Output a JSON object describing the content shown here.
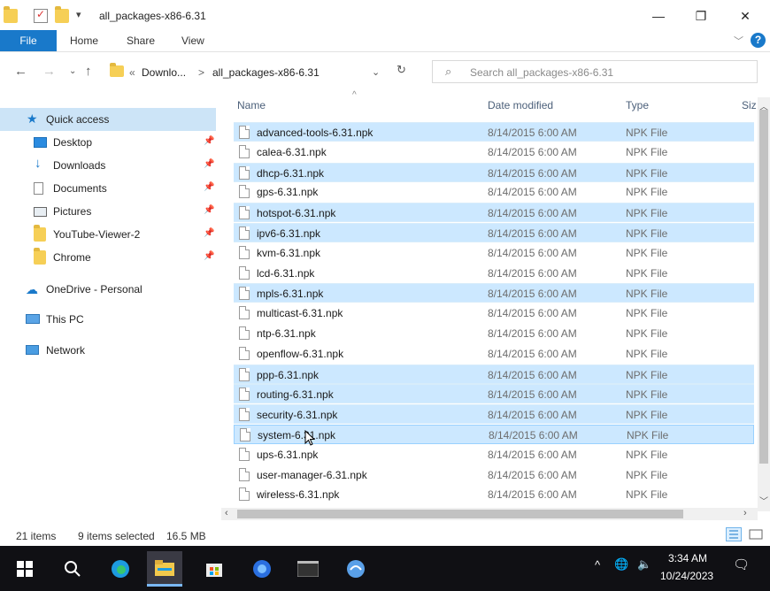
{
  "window": {
    "title": "all_packages-x86-6.31",
    "minimize": "—",
    "restore": "❐",
    "close": "✕"
  },
  "ribbon": {
    "tabs": [
      "File",
      "Home",
      "Share",
      "View"
    ],
    "help": "?"
  },
  "address": {
    "breadcrumb_prefix": "«",
    "crumbs": [
      "Downlo...",
      "all_packages-x86-6.31"
    ],
    "separator": ">"
  },
  "search": {
    "placeholder": "Search all_packages-x86-6.31"
  },
  "nav": {
    "items": [
      {
        "label": "Quick access"
      },
      {
        "label": "Desktop"
      },
      {
        "label": "Downloads"
      },
      {
        "label": "Documents"
      },
      {
        "label": "Pictures"
      },
      {
        "label": "YouTube-Viewer-2"
      },
      {
        "label": "Chrome"
      },
      {
        "label": "OneDrive - Personal"
      },
      {
        "label": "This PC"
      },
      {
        "label": "Network"
      }
    ]
  },
  "columns": {
    "name": "Name",
    "date": "Date modified",
    "type": "Type",
    "size": "Siz"
  },
  "files": [
    {
      "name": "advanced-tools-6.31.npk",
      "date": "8/14/2015 6:00 AM",
      "type": "NPK File",
      "selected": true
    },
    {
      "name": "calea-6.31.npk",
      "date": "8/14/2015 6:00 AM",
      "type": "NPK File",
      "selected": false
    },
    {
      "name": "dhcp-6.31.npk",
      "date": "8/14/2015 6:00 AM",
      "type": "NPK File",
      "selected": true
    },
    {
      "name": "gps-6.31.npk",
      "date": "8/14/2015 6:00 AM",
      "type": "NPK File",
      "selected": false
    },
    {
      "name": "hotspot-6.31.npk",
      "date": "8/14/2015 6:00 AM",
      "type": "NPK File",
      "selected": true
    },
    {
      "name": "ipv6-6.31.npk",
      "date": "8/14/2015 6:00 AM",
      "type": "NPK File",
      "selected": true
    },
    {
      "name": "kvm-6.31.npk",
      "date": "8/14/2015 6:00 AM",
      "type": "NPK File",
      "selected": false
    },
    {
      "name": "lcd-6.31.npk",
      "date": "8/14/2015 6:00 AM",
      "type": "NPK File",
      "selected": false
    },
    {
      "name": "mpls-6.31.npk",
      "date": "8/14/2015 6:00 AM",
      "type": "NPK File",
      "selected": true
    },
    {
      "name": "multicast-6.31.npk",
      "date": "8/14/2015 6:00 AM",
      "type": "NPK File",
      "selected": false
    },
    {
      "name": "ntp-6.31.npk",
      "date": "8/14/2015 6:00 AM",
      "type": "NPK File",
      "selected": false
    },
    {
      "name": "openflow-6.31.npk",
      "date": "8/14/2015 6:00 AM",
      "type": "NPK File",
      "selected": false
    },
    {
      "name": "ppp-6.31.npk",
      "date": "8/14/2015 6:00 AM",
      "type": "NPK File",
      "selected": true
    },
    {
      "name": "routing-6.31.npk",
      "date": "8/14/2015 6:00 AM",
      "type": "NPK File",
      "selected": true
    },
    {
      "name": "security-6.31.npk",
      "date": "8/14/2015 6:00 AM",
      "type": "NPK File",
      "selected": true
    },
    {
      "name": "system-6.31.npk",
      "date": "8/14/2015 6:00 AM",
      "type": "NPK File",
      "selected": true
    },
    {
      "name": "ups-6.31.npk",
      "date": "8/14/2015 6:00 AM",
      "type": "NPK File",
      "selected": false
    },
    {
      "name": "user-manager-6.31.npk",
      "date": "8/14/2015 6:00 AM",
      "type": "NPK File",
      "selected": false
    },
    {
      "name": "wireless-6.31.npk",
      "date": "8/14/2015 6:00 AM",
      "type": "NPK File",
      "selected": false
    }
  ],
  "status": {
    "item_count": "21 items",
    "selection": "9 items selected",
    "size": "16.5 MB"
  },
  "taskbar": {
    "time": "3:34 AM",
    "date": "10/24/2023"
  },
  "colors": {
    "accent": "#1979ca",
    "selection": "#cce8ff",
    "quick_access_highlight": "#cce4f7",
    "taskbar": "#101014"
  }
}
